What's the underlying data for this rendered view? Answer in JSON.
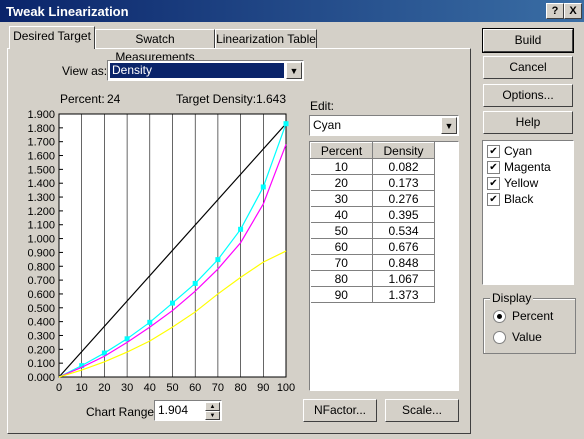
{
  "window": {
    "title": "Tweak Linearization",
    "help_glyph": "?",
    "close_glyph": "X"
  },
  "tabs": [
    {
      "label": "Desired Target",
      "active": true
    },
    {
      "label": "Swatch Measurements",
      "active": false
    },
    {
      "label": "Linearization Table",
      "active": false
    }
  ],
  "view_as": {
    "label": "View as:",
    "value": "Density"
  },
  "readout": {
    "percent_label": "Percent:",
    "percent_value": "24",
    "target_label": "Target Density:",
    "target_value": "1.643"
  },
  "edit": {
    "label": "Edit:",
    "value": "Cyan"
  },
  "table": {
    "headers": [
      "Percent",
      "Density"
    ],
    "rows": [
      [
        "10",
        "0.082"
      ],
      [
        "20",
        "0.173"
      ],
      [
        "30",
        "0.276"
      ],
      [
        "40",
        "0.395"
      ],
      [
        "50",
        "0.534"
      ],
      [
        "60",
        "0.676"
      ],
      [
        "70",
        "0.848"
      ],
      [
        "80",
        "1.067"
      ],
      [
        "90",
        "1.373"
      ]
    ]
  },
  "chart_range": {
    "label": "Chart Range:",
    "value": "1.904"
  },
  "buttons": {
    "nfactor": "NFactor...",
    "scale": "Scale...",
    "build": "Build",
    "cancel": "Cancel",
    "options": "Options...",
    "help": "Help"
  },
  "channels": [
    {
      "label": "Cyan",
      "checked": true
    },
    {
      "label": "Magenta",
      "checked": true
    },
    {
      "label": "Yellow",
      "checked": true
    },
    {
      "label": "Black",
      "checked": true
    }
  ],
  "display": {
    "group_label": "Display",
    "options": [
      "Percent",
      "Value"
    ],
    "selected": "Percent"
  },
  "colors": {
    "cyan": "#00ffff",
    "magenta": "#ff00ff",
    "yellow": "#ffff00",
    "black": "#000000",
    "grid": "#000000"
  },
  "chart_data": {
    "type": "line",
    "x_ticks": [
      "0",
      "10",
      "20",
      "30",
      "40",
      "50",
      "60",
      "70",
      "80",
      "90",
      "100"
    ],
    "y_ticks": [
      "0.000",
      "0.100",
      "0.200",
      "0.300",
      "0.400",
      "0.500",
      "0.600",
      "0.700",
      "0.800",
      "0.900",
      "1.000",
      "1.100",
      "1.200",
      "1.300",
      "1.400",
      "1.500",
      "1.600",
      "1.700",
      "1.800",
      "1.900"
    ],
    "xlim": [
      0,
      100
    ],
    "ylim": [
      0,
      1.9
    ],
    "grid": true,
    "series": [
      {
        "color": "black",
        "x": [
          0,
          100
        ],
        "y": [
          0,
          1.83
        ]
      },
      {
        "color": "cyan",
        "x": [
          0,
          10,
          20,
          30,
          40,
          50,
          60,
          70,
          80,
          90,
          100
        ],
        "y": [
          0,
          0.082,
          0.173,
          0.276,
          0.395,
          0.534,
          0.676,
          0.848,
          1.067,
          1.373,
          1.83
        ],
        "markers": true
      },
      {
        "color": "magenta",
        "x": [
          0,
          10,
          20,
          30,
          40,
          50,
          60,
          70,
          80,
          90,
          100
        ],
        "y": [
          0,
          0.07,
          0.15,
          0.25,
          0.36,
          0.48,
          0.62,
          0.78,
          0.97,
          1.25,
          1.68
        ]
      },
      {
        "color": "yellow",
        "x": [
          0,
          10,
          20,
          30,
          40,
          50,
          60,
          70,
          80,
          90,
          100
        ],
        "y": [
          0,
          0.05,
          0.11,
          0.18,
          0.26,
          0.36,
          0.47,
          0.6,
          0.72,
          0.83,
          0.91
        ]
      }
    ]
  }
}
